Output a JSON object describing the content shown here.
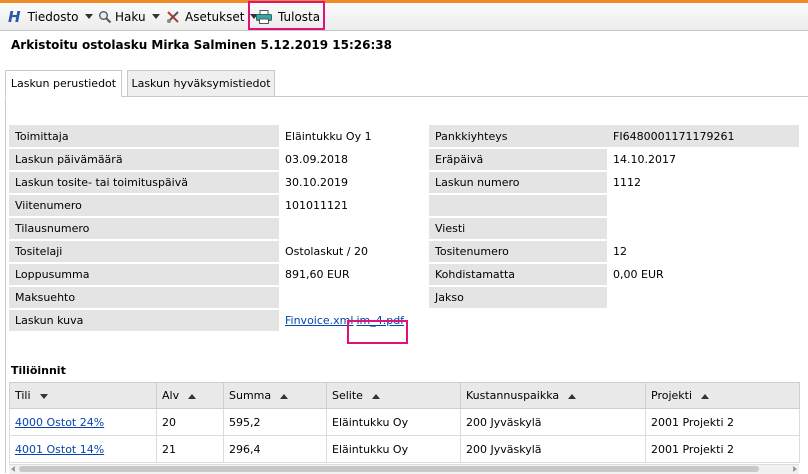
{
  "menu": {
    "file": "Tiedosto",
    "search": "Haku",
    "settings": "Asetukset",
    "print": "Tulosta"
  },
  "page_title": "Arkistoitu ostolasku Mirka Salminen 5.12.2019 15:26:38",
  "tabs": [
    "Laskun perustiedot",
    "Laskun hyväksymistiedot"
  ],
  "fields": [
    {
      "label": "Toimittaja",
      "value": "Eläintukku Oy  1",
      "label2": "Pankkiyhteys",
      "value2": "FI6480001171179261"
    },
    {
      "label": "Laskun päivämäärä",
      "value": "03.09.2018",
      "label2": "Eräpäivä",
      "value2": "14.10.2017"
    },
    {
      "label": "Laskun tosite- tai toimituspäivä",
      "value": "30.10.2019",
      "label2": "Laskun numero",
      "value2": "1112"
    },
    {
      "label": "Viitenumero",
      "value": "101011121",
      "label2": "",
      "value2": ""
    },
    {
      "label": "Tilausnumero",
      "value": "",
      "label2": "Viesti",
      "value2": ""
    },
    {
      "label": "Tositelaji",
      "value": "Ostolaskut / 20",
      "label2": "Tositenumero",
      "value2": "12"
    },
    {
      "label": "Loppusumma",
      "value": "891,60 EUR",
      "label2": "Kohdistamatta",
      "value2": "0,00 EUR"
    },
    {
      "label": "Maksuehto",
      "value": "",
      "label2": "Jakso",
      "value2": ""
    }
  ],
  "invoice_image": {
    "label": "Laskun kuva",
    "link1": "Finvoice.xml",
    "link2": "im_4.pdf"
  },
  "accounts": {
    "title": "Tiliöinnit",
    "columns": [
      "Tili",
      "Alv",
      "Summa",
      "Selite",
      "Kustannuspaikka",
      "Projekti"
    ],
    "rows": [
      [
        "4000 Ostot 24%",
        "20",
        "595,2",
        "Eläintukku Oy",
        "200 Jyväskylä",
        "2001 Projekti 2"
      ],
      [
        "4001 Ostot 14%",
        "21",
        "296,4",
        "Eläintukku Oy",
        "200 Jyväskylä",
        "2001 Projekti 2"
      ]
    ]
  },
  "colors": {
    "accent": "#f08c28",
    "highlight": "#e0127a",
    "link": "#0645ad",
    "label_bg": "#e4e4e4"
  }
}
